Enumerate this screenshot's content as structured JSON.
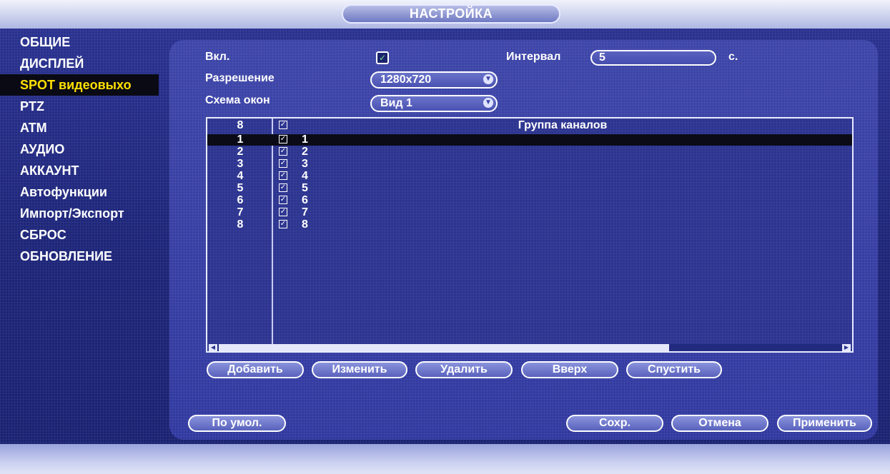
{
  "window": {
    "title": "НАСТРОЙКА"
  },
  "sidebar": {
    "items": [
      {
        "label": "ОБЩИЕ"
      },
      {
        "label": "ДИСПЛЕЙ"
      },
      {
        "label": "SPOT видеовыхо",
        "active": true
      },
      {
        "label": "PTZ"
      },
      {
        "label": "ATM"
      },
      {
        "label": "АУДИО"
      },
      {
        "label": "АККАУНТ"
      },
      {
        "label": "Автофункции"
      },
      {
        "label": "Импорт/Экспорт"
      },
      {
        "label": "СБРОС"
      },
      {
        "label": "ОБНОВЛЕНИЕ"
      }
    ]
  },
  "form": {
    "enable_label": "Вкл.",
    "enable_checked": true,
    "interval_label": "Интервал",
    "interval_value": "5",
    "interval_unit": "с.",
    "resolution_label": "Разрешение",
    "resolution_value": "1280x720",
    "layout_label": "Схема окон",
    "layout_value": "Вид 1"
  },
  "table": {
    "header_count": "8",
    "header_checked": true,
    "header_title": "Группа каналов",
    "selected_row": 0,
    "rows": [
      {
        "num": "1",
        "name": "1",
        "checked": true
      },
      {
        "num": "2",
        "name": "2",
        "checked": true
      },
      {
        "num": "3",
        "name": "3",
        "checked": true
      },
      {
        "num": "4",
        "name": "4",
        "checked": true
      },
      {
        "num": "5",
        "name": "5",
        "checked": true
      },
      {
        "num": "6",
        "name": "6",
        "checked": true
      },
      {
        "num": "7",
        "name": "7",
        "checked": true
      },
      {
        "num": "8",
        "name": "8",
        "checked": true
      }
    ]
  },
  "actions": {
    "add": "Добавить",
    "edit": "Изменить",
    "delete": "Удалить",
    "up": "Вверх",
    "down": "Спустить"
  },
  "footer": {
    "default": "По умол.",
    "save": "Сохр.",
    "cancel": "Отмена",
    "apply": "Применить"
  },
  "icons": {
    "check": "check-icon",
    "dropdown": "dropdown-arrow-icon",
    "scroll_left": "scroll-left-icon",
    "scroll_right": "scroll-right-icon"
  },
  "colors": {
    "active_text": "#ffe000",
    "panel": "#3139a0",
    "check": "#7de38f"
  }
}
